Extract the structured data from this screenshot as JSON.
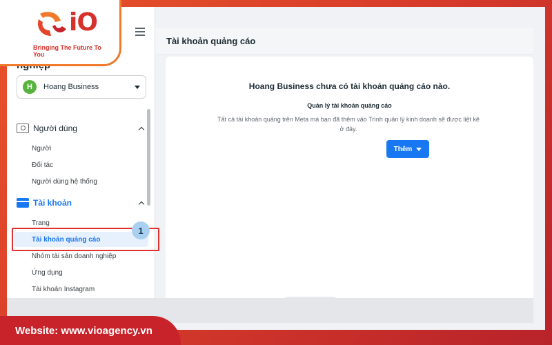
{
  "brand": {
    "logo_text": "iO",
    "tagline": "Bringing The Future To You",
    "footer_website": "Website: www.vioagency.vn"
  },
  "sidebar": {
    "workspace_title": "nghiệp",
    "business": {
      "avatar_letter": "H",
      "name": "Hoang Business"
    },
    "sections": [
      {
        "label": "Người dùng",
        "icon": "user-icon",
        "items": [
          "Người",
          "Đối tác",
          "Người dùng hệ thống"
        ]
      },
      {
        "label": "Tài khoản",
        "icon": "account-box-icon",
        "active": true,
        "items": [
          "Trang",
          "Tài khoản quảng cáo",
          "Nhóm tài sản doanh nghiệp",
          "Ứng dụng",
          "Tài khoản Instagram"
        ],
        "selected_item": "Tài khoản quảng cáo"
      }
    ],
    "step_badge": "1"
  },
  "main": {
    "title": "Tài khoản quảng cáo",
    "empty_state": {
      "title": "Hoang Business chưa có tài khoản quảng cáo nào.",
      "subtitle": "Quản lý tài khoản quảng cáo",
      "description": "Tất cả tài khoản quảng trên Meta mà bạn đã thêm vào Trình quản lý kinh doanh sẽ được liệt kê ở đây.",
      "add_button": "Thêm"
    }
  },
  "colors": {
    "accent": "#1877f2",
    "highlight": "#e0312f",
    "brand_red": "#d6312a",
    "brand_orange": "#f07a2a"
  }
}
